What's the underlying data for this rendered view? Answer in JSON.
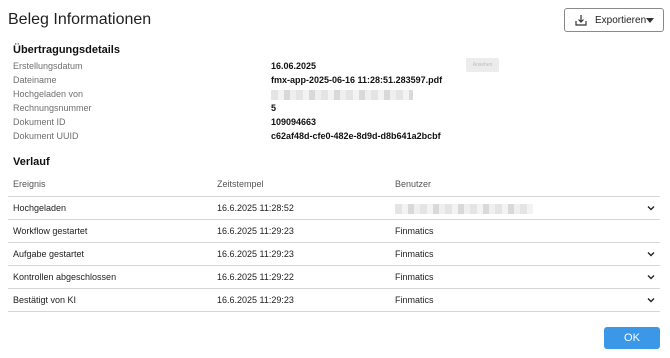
{
  "dialog": {
    "title": "Beleg Informationen"
  },
  "export": {
    "label": "Exportieren"
  },
  "details": {
    "title": "Übertragungsdetails",
    "rows": [
      {
        "label": "Erstellungsdatum",
        "value": "16.06.2025"
      },
      {
        "label": "Dateiname",
        "value": "fmx-app-2025-06-16 11:28:51.283597.pdf"
      },
      {
        "label": "Hochgeladen von",
        "value": ""
      },
      {
        "label": "Rechnungsnummer",
        "value": "5"
      },
      {
        "label": "Dokument ID",
        "value": "109094663"
      },
      {
        "label": "Dokument UUID",
        "value": "c62af48d-cfe0-482e-8d9d-d8b641a2bcbf"
      }
    ],
    "small_button_label": "Ansehen"
  },
  "history": {
    "title": "Verlauf",
    "columns": [
      "Ereignis",
      "Zeitstempel",
      "Benutzer"
    ],
    "rows": [
      {
        "event": "Hochgeladen",
        "timestamp": "16.6.2025 11:28:52",
        "user": "",
        "expandable": true
      },
      {
        "event": "Workflow gestartet",
        "timestamp": "16.6.2025 11:29:23",
        "user": "Finmatics",
        "expandable": false
      },
      {
        "event": "Aufgabe gestartet",
        "timestamp": "16.6.2025 11:29:23",
        "user": "Finmatics",
        "expandable": true
      },
      {
        "event": "Kontrollen abgeschlossen",
        "timestamp": "16.6.2025 11:29:22",
        "user": "Finmatics",
        "expandable": true
      },
      {
        "event": "Bestätigt von KI",
        "timestamp": "16.6.2025 11:29:23",
        "user": "Finmatics",
        "expandable": true
      }
    ]
  },
  "footer": {
    "ok_label": "OK"
  },
  "colors": {
    "primary": "#3b97e8",
    "divider": "#d6d6d6",
    "label": "#6f6f6f"
  },
  "icons": {
    "export": "download-tray-icon",
    "dropdown": "caret-down-icon",
    "expand": "chevron-down-icon"
  }
}
